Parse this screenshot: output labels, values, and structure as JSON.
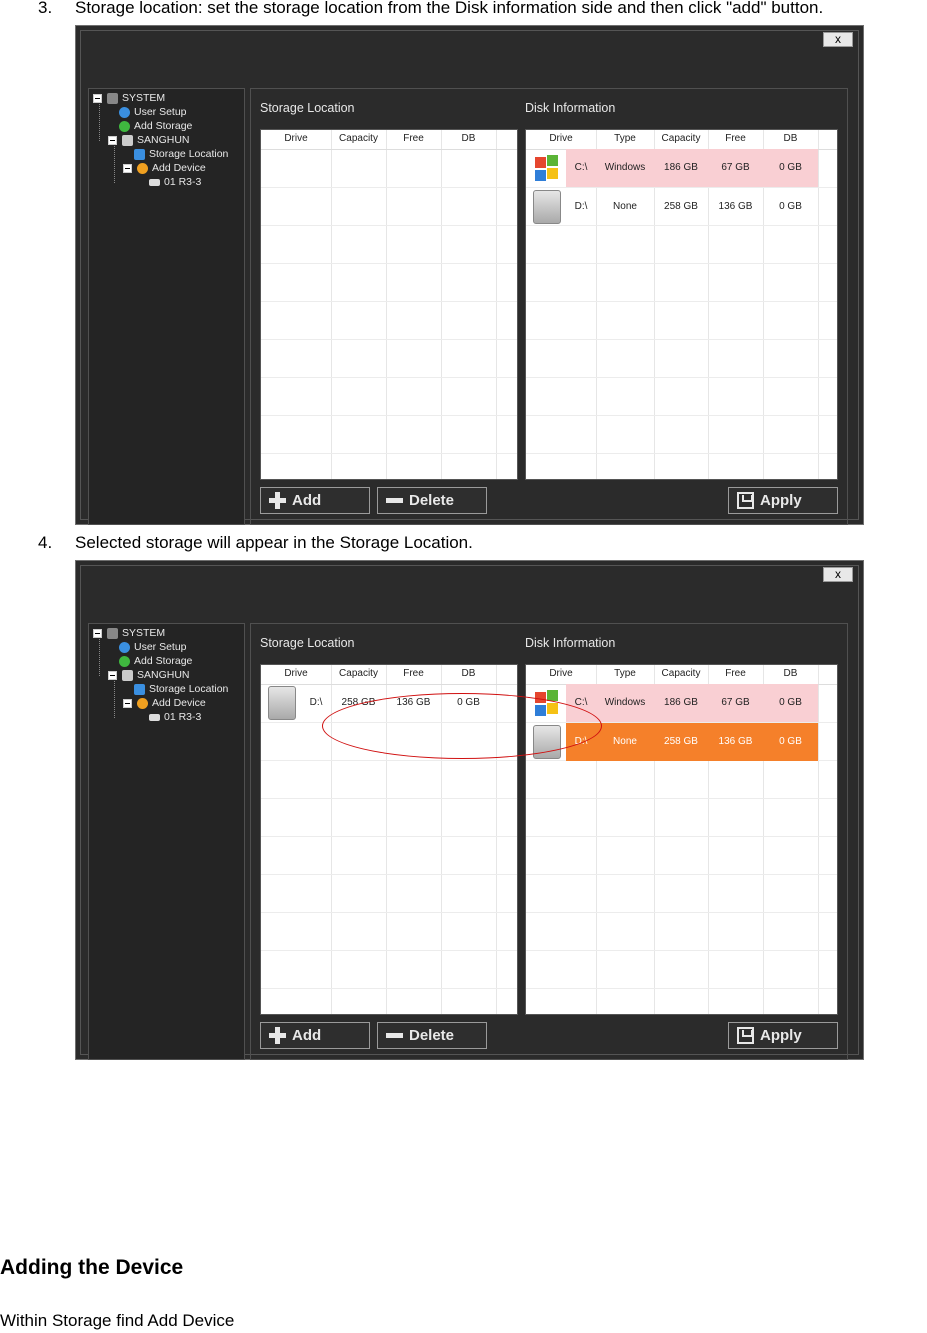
{
  "steps": [
    {
      "num": "3.",
      "text": "Storage location: set the storage location from the Disk information side and then click \"add\" button."
    },
    {
      "num": "4.",
      "text": "Selected storage will appear in the Storage Location."
    }
  ],
  "heading": "Adding the Device",
  "paragraph": "Within Storage find Add Device",
  "window": {
    "close_label": "x",
    "tree": {
      "system": "SYSTEM",
      "user_setup": "User Setup",
      "add_storage": "Add Storage",
      "sanghun": "SANGHUN",
      "storage_location": "Storage Location",
      "add_device": "Add Device",
      "camera": "01 R3-3"
    },
    "storage_location_title": "Storage Location",
    "disk_information_title": "Disk Information",
    "storage_columns": [
      "Drive",
      "Capacity",
      "Free",
      "DB"
    ],
    "disk_columns": [
      "Drive",
      "Type",
      "Capacity",
      "Free",
      "DB"
    ],
    "disks": [
      {
        "drive": "C:\\",
        "type": "Windows",
        "capacity": "186 GB",
        "free": "67 GB",
        "db": "0 GB",
        "icon": "windows-logo"
      },
      {
        "drive": "D:\\",
        "type": "None",
        "capacity": "258 GB",
        "free": "136 GB",
        "db": "0 GB",
        "icon": "hard-disk"
      }
    ],
    "storage_rows_after": [
      {
        "drive": "D:\\",
        "capacity": "258 GB",
        "free": "136 GB",
        "db": "0 GB",
        "icon": "hard-disk"
      }
    ],
    "buttons": {
      "add": "Add",
      "delete": "Delete",
      "apply": "Apply"
    },
    "colors": {
      "c_row": "#f9cfd3",
      "selected_row": "#f5802a",
      "annotation": "#d01010"
    }
  }
}
